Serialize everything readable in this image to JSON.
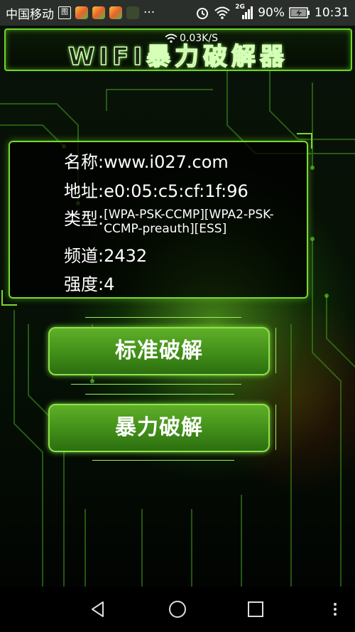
{
  "status_bar": {
    "carrier": "中国移动",
    "carrier_icon_text": "图",
    "overflow": "···",
    "network_type": "2G",
    "battery": "90%",
    "time": "10:31"
  },
  "header": {
    "title": "WIFI暴力破解器",
    "speed": "0.03K/S"
  },
  "wifi_info": {
    "name_label": "名称:",
    "name": "www.i027.com",
    "address_label": "地址:",
    "address": "e0:05:c5:cf:1f:96",
    "type_label": "类型:",
    "type": "[WPA-PSK-CCMP][WPA2-PSK-CCMP-preauth][ESS]",
    "channel_label": "频道:",
    "channel": "2432",
    "strength_label": "强度:",
    "strength": "4"
  },
  "actions": {
    "standard_label": "标准破解",
    "brute_label": "暴力破解"
  },
  "nav": {
    "back": "back-icon",
    "home": "home-icon",
    "recents": "recents-icon",
    "menu": "menu-icon"
  },
  "colors": {
    "accent": "#7ad932",
    "button": "#4e9d20"
  }
}
